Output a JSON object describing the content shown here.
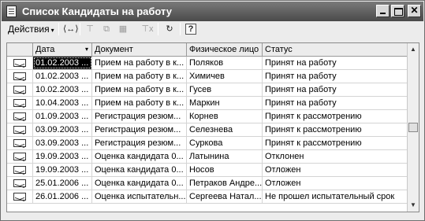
{
  "window": {
    "title": "Список Кандидаты на работу",
    "controls": {
      "minimize": "",
      "maximize": "",
      "close": "✕"
    }
  },
  "toolbar": {
    "actions_label": "Действия",
    "actions_arrow": "▾",
    "icons": {
      "expand": "⟨↔⟩",
      "filter": "⊤",
      "copy": "⧉",
      "delete": "▦",
      "clear_filter": "⊤x",
      "refresh": "↻",
      "help": "?"
    }
  },
  "grid": {
    "columns": [
      "",
      "Дата",
      "Документ",
      "Физическое лицо",
      "Статус"
    ],
    "sorted_column_arrow": "▾",
    "rows": [
      {
        "date": "01.02.2003 ...",
        "document": "Прием на работу в к...",
        "person": "Поляков",
        "status": "Принят на работу"
      },
      {
        "date": "01.02.2003 ...",
        "document": "Прием на работу в к...",
        "person": "Химичев",
        "status": "Принят на работу"
      },
      {
        "date": "10.02.2003 ...",
        "document": "Прием на работу в к...",
        "person": "Гусев",
        "status": "Принят на работу"
      },
      {
        "date": "10.04.2003 ...",
        "document": "Прием на работу в к...",
        "person": "Маркин",
        "status": "Принят на работу"
      },
      {
        "date": "01.09.2003 ...",
        "document": "Регистрация резюм...",
        "person": "Корнев",
        "status": "Принят к рассмотрению"
      },
      {
        "date": "03.09.2003 ...",
        "document": "Регистрация резюм...",
        "person": "Селезнева",
        "status": "Принят к рассмотрению"
      },
      {
        "date": "03.09.2003 ...",
        "document": "Регистрация резюм...",
        "person": "Суркова",
        "status": "Принят к рассмотрению"
      },
      {
        "date": "19.09.2003 ...",
        "document": "Оценка кандидата 0...",
        "person": "Латынина",
        "status": "Отклонен"
      },
      {
        "date": "19.09.2003 ...",
        "document": "Оценка кандидата 0...",
        "person": "Носов",
        "status": "Отложен"
      },
      {
        "date": "25.01.2006 ...",
        "document": "Оценка кандидата 0...",
        "person": "Петраков Андре...",
        "status": "Отложен"
      },
      {
        "date": "26.01.2006 ...",
        "document": "Оценка испытательн...",
        "person": "Сергеева Натал...",
        "status": "Не прошел испытательный срок"
      }
    ],
    "selected_row_index": 0
  },
  "scrollbar": {
    "up": "▲",
    "down": "▼",
    "position": 0.5
  }
}
